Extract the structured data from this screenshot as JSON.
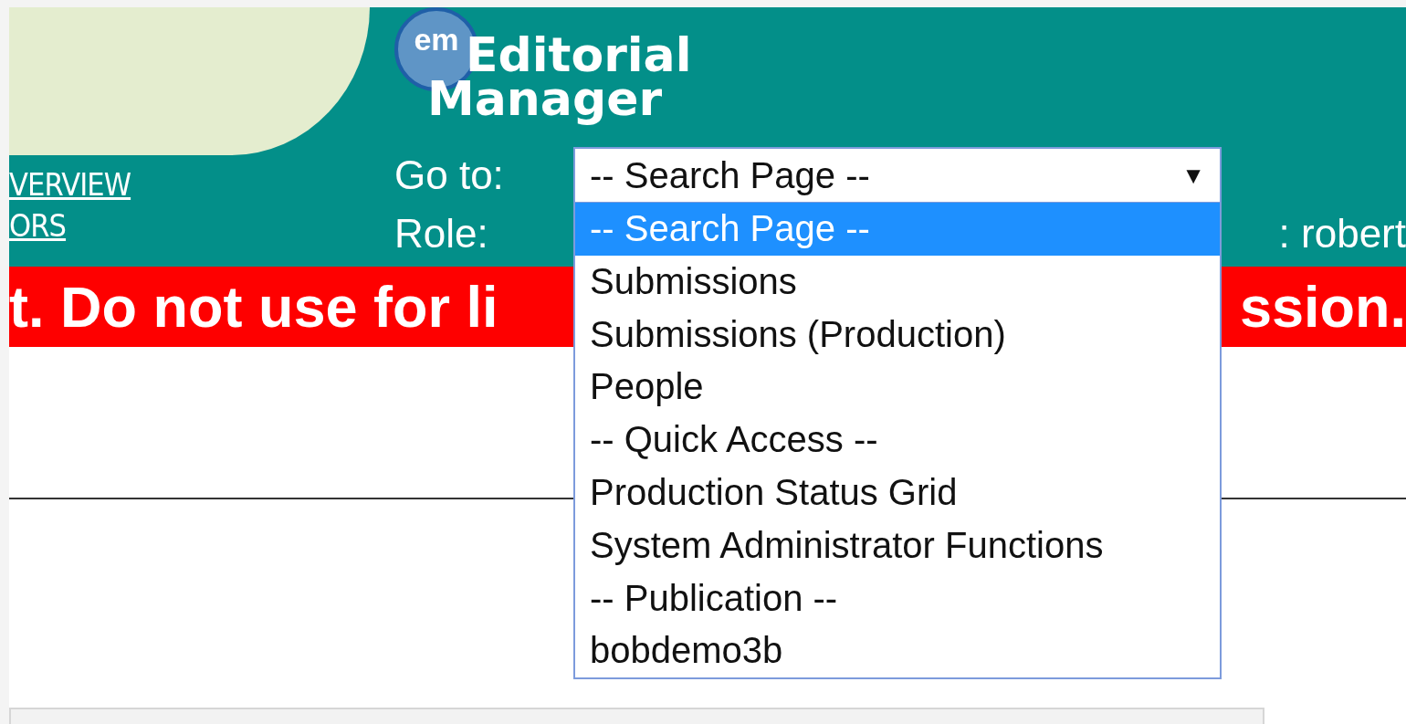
{
  "header": {
    "nav_links": [
      "VERVIEW",
      "ORS"
    ],
    "logo": {
      "badge": "em",
      "line1": "Editorial",
      "line2": "Manager"
    },
    "goto_label": "Go to:",
    "role_label": "Role:",
    "user_text": ": robert",
    "goto_select": {
      "value": "-- Search Page --",
      "caret": "▼",
      "expanded": true,
      "options": [
        {
          "label": "-- Search Page --",
          "selected": true
        },
        {
          "label": "Submissions",
          "selected": false
        },
        {
          "label": "Submissions (Production)",
          "selected": false
        },
        {
          "label": "People",
          "selected": false
        },
        {
          "label": "-- Quick Access --",
          "selected": false
        },
        {
          "label": "Production Status Grid",
          "selected": false
        },
        {
          "label": "System Administrator Functions",
          "selected": false
        },
        {
          "label": "-- Publication --",
          "selected": false
        },
        {
          "label": "bobdemo3b",
          "selected": false
        }
      ]
    }
  },
  "banner": {
    "left_text": "t. Do not use for li",
    "right_text": "ssion."
  }
}
